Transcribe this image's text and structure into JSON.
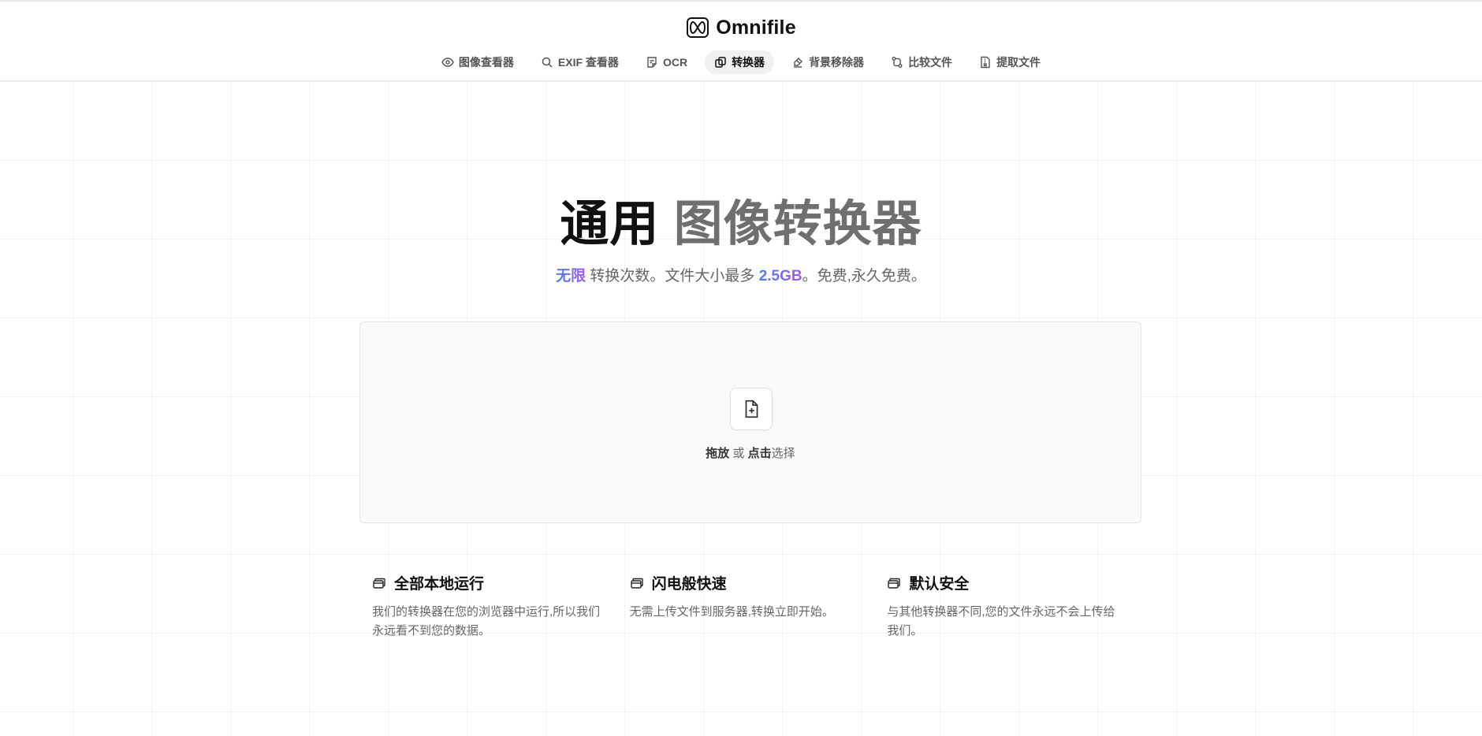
{
  "brand": {
    "name": "Omnifile",
    "logo_icon": "infinity-logo-icon"
  },
  "nav": [
    {
      "label": "图像查看器",
      "icon": "eye-icon",
      "active": false
    },
    {
      "label": "EXIF 查看器",
      "icon": "search-icon",
      "active": false
    },
    {
      "label": "OCR",
      "icon": "note-icon",
      "active": false
    },
    {
      "label": "转换器",
      "icon": "convert-icon",
      "active": true
    },
    {
      "label": "背景移除器",
      "icon": "eraser-icon",
      "active": false
    },
    {
      "label": "比较文件",
      "icon": "git-compare-icon",
      "active": false
    },
    {
      "label": "提取文件",
      "icon": "file-archive-icon",
      "active": false
    }
  ],
  "hero": {
    "title_main": "通用",
    "title_accent": "图像转换器",
    "sub_highlight_1": "无限",
    "sub_text_1": " 转换次数。文件大小最多 ",
    "sub_highlight_2": "2.5GB",
    "sub_text_2": "。免费,永久免费。"
  },
  "dropzone": {
    "icon": "file-plus-icon",
    "drag_label": "拖放",
    "or_label": " 或 ",
    "click_label": "点击",
    "select_label": "选择"
  },
  "features": [
    {
      "icon": "cards-icon",
      "title": "全部本地运行",
      "desc": "我们的转换器在您的浏览器中运行,所以我们永远看不到您的数据。"
    },
    {
      "icon": "cards-icon",
      "title": "闪电般快速",
      "desc": "无需上传文件到服务器,转换立即开始。"
    },
    {
      "icon": "cards-icon",
      "title": "默认安全",
      "desc": "与其他转换器不同,您的文件永远不会上传给我们。"
    }
  ],
  "colors": {
    "gradient_start": "#4f7df0",
    "gradient_end": "#a45ae8",
    "active_tab_bg": "#f0f0f0",
    "dropzone_bg": "#f9f9f9"
  }
}
